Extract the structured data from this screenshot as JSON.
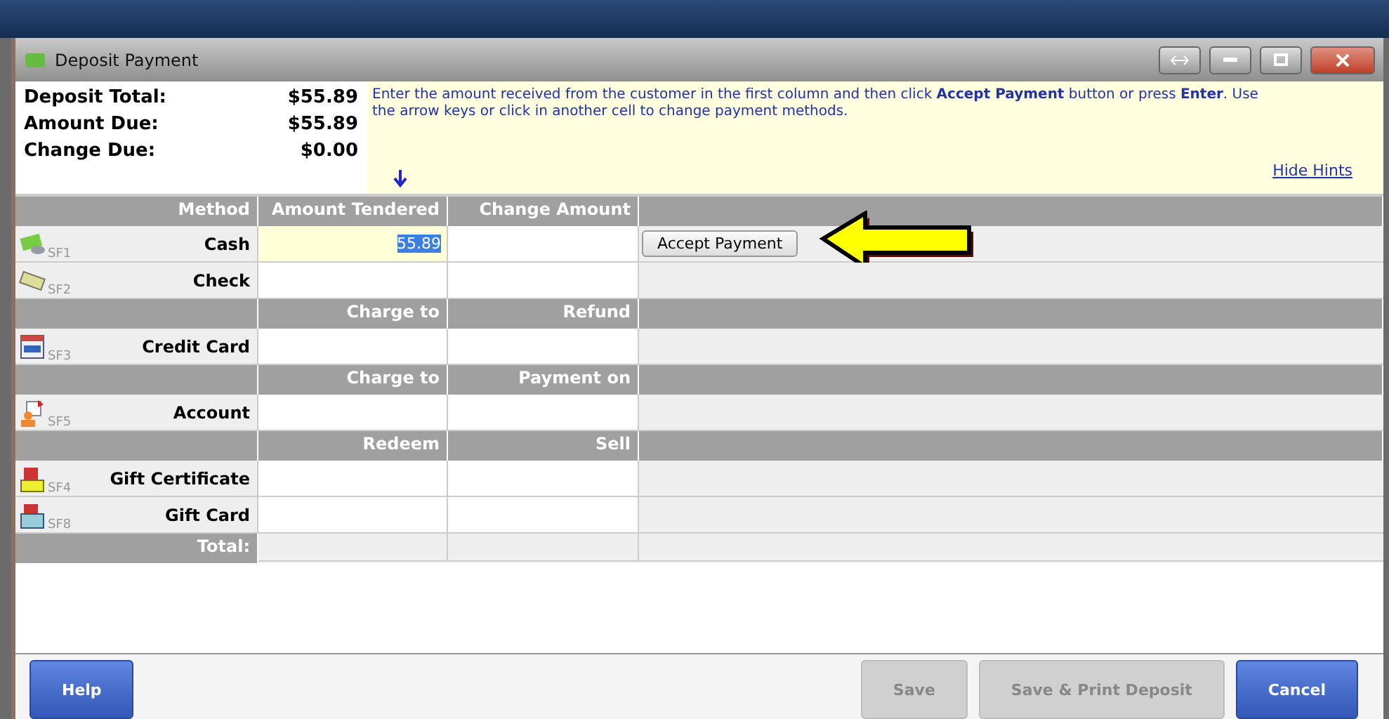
{
  "window": {
    "title": "Deposit Payment"
  },
  "summary": [
    {
      "label": "Deposit Total:",
      "value": "$55.89"
    },
    {
      "label": "Amount Due:",
      "value": "$55.89"
    },
    {
      "label": "Change Due:",
      "value": "$0.00"
    }
  ],
  "hint": {
    "text": "Enter the amount received from the customer in the first column and then click **Accept Payment** button or press **Enter**. Use the arrow keys or click in another cell to change payment methods.",
    "link": "Hide Hints"
  },
  "sections": [
    {
      "headers": {
        "method": "Method",
        "amount": "Amount Tendered",
        "change": "Change Amount"
      },
      "rows": [
        {
          "kind": "cash",
          "key": "SF1",
          "label": "Cash",
          "amount": "55.89",
          "selected": true,
          "action": "Accept Payment"
        },
        {
          "kind": "check",
          "key": "SF2",
          "label": "Check",
          "selected": false
        }
      ]
    },
    {
      "headers": {
        "amount": "Charge to",
        "change": "Refund"
      },
      "rows": [
        {
          "kind": "card",
          "key": "SF3",
          "label": "Credit Card",
          "selected": false
        }
      ]
    },
    {
      "headers": {
        "amount": "Charge to",
        "change": "Payment on"
      },
      "rows": [
        {
          "kind": "account",
          "key": "SF5",
          "label": "Account",
          "selected": false
        }
      ]
    },
    {
      "headers": {
        "amount": "Redeem",
        "change": "Sell"
      },
      "rows": [
        {
          "kind": "certificate",
          "key": "SF4",
          "label": "Gift Certificate",
          "selected": false
        },
        {
          "kind": "giftcard",
          "key": "SF8",
          "label": "Gift Card",
          "selected": false
        }
      ]
    }
  ],
  "total_label": "Total:",
  "buttons": [
    {
      "label": "Help",
      "disabled": false
    },
    {
      "label": "Save",
      "disabled": true
    },
    {
      "label": "Save & Print Deposit",
      "disabled": true
    },
    {
      "label": "Cancel",
      "disabled": false
    }
  ]
}
